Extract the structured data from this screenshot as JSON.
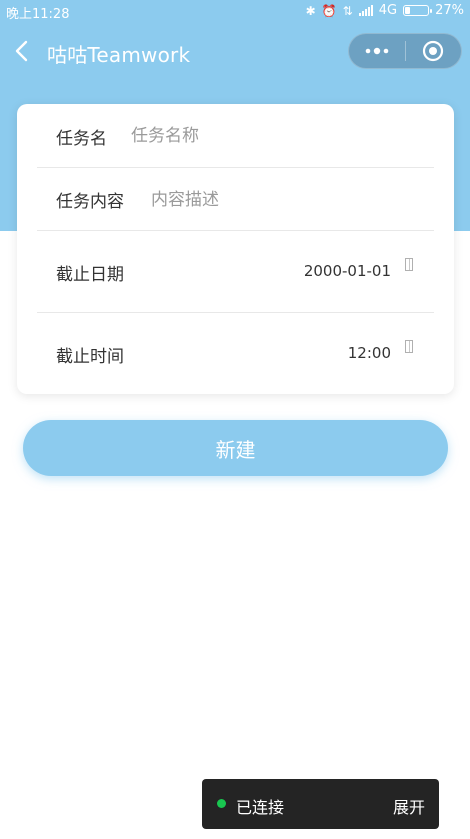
{
  "status_bar": {
    "time": "晚上11:28",
    "network": "4G",
    "battery": "27%",
    "battery_level": 0.27
  },
  "nav": {
    "title": "咕咕Teamwork",
    "back_icon": "chevron-left-icon",
    "more_icon": "more-dots-icon",
    "close_icon": "target-icon"
  },
  "form": {
    "task_name": {
      "label": "任务名",
      "value": "",
      "placeholder": "任务名称"
    },
    "task_content": {
      "label": "任务内容",
      "value": "",
      "placeholder": "内容描述"
    },
    "deadline_date": {
      "label": "截止日期",
      "value": "2000-01-01"
    },
    "deadline_time": {
      "label": "截止时间",
      "value": "12:00"
    }
  },
  "create_button": {
    "label": "新建"
  },
  "toast": {
    "status": "已连接",
    "expand": "展开",
    "dot_color": "#19c650"
  },
  "colors": {
    "primary": "#8ccbee"
  }
}
